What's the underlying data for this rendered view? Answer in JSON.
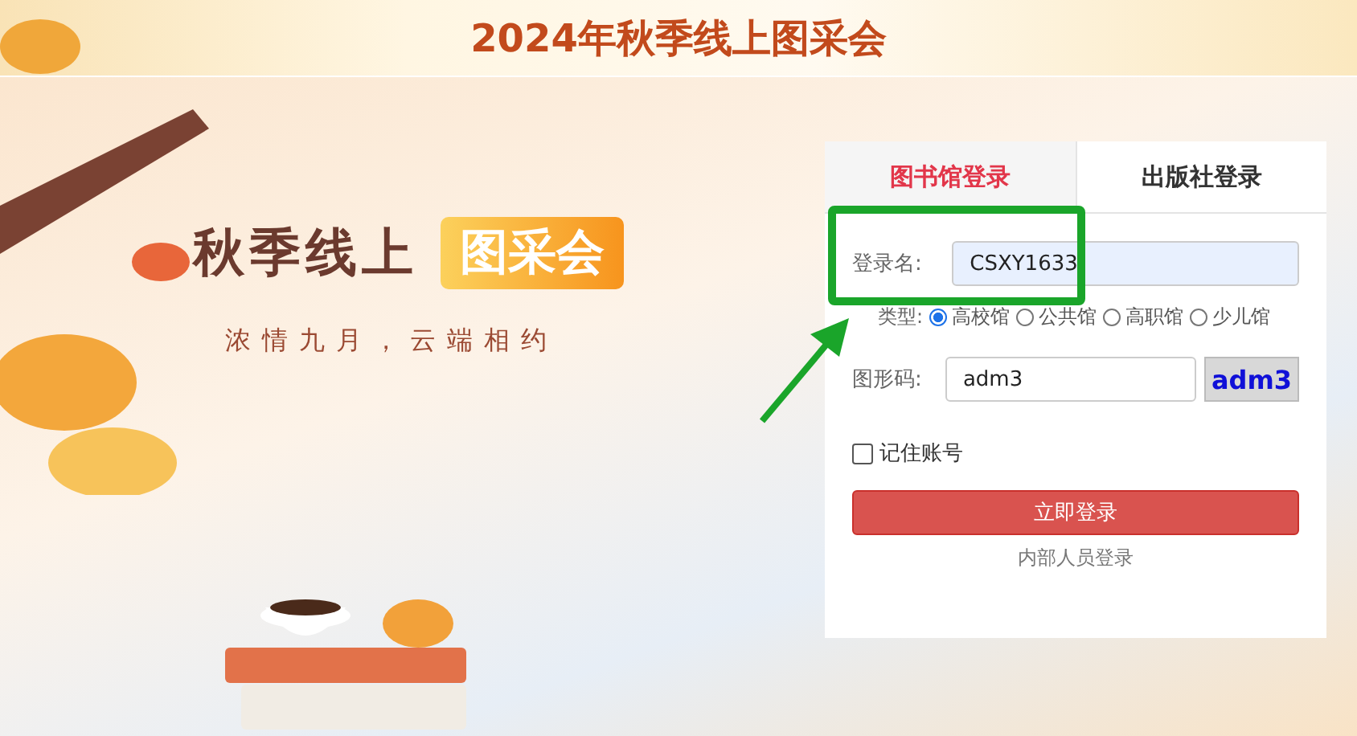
{
  "banner": {
    "title": "2024年秋季线上图采会"
  },
  "hero": {
    "title": "秋季线上",
    "badge": "图采会",
    "slogan": "浓情九月，云端相约"
  },
  "login": {
    "tabs": [
      {
        "label": "图书馆登录",
        "selected": true
      },
      {
        "label": "出版社登录",
        "selected": false
      }
    ],
    "username": {
      "label": "登录名:",
      "value": "CSXY1633"
    },
    "type": {
      "label": "类型:",
      "options": [
        {
          "label": "高校馆",
          "selected": true
        },
        {
          "label": "公共馆",
          "selected": false
        },
        {
          "label": "高职馆",
          "selected": false
        },
        {
          "label": "少儿馆",
          "selected": false
        }
      ]
    },
    "captcha": {
      "label": "图形码:",
      "value": "adm3",
      "image_text": "adm3"
    },
    "remember": {
      "label": "记住账号",
      "checked": false
    },
    "submit": "立即登录",
    "internal_link": "内部人员登录"
  },
  "annotation": {
    "highlight": true
  }
}
